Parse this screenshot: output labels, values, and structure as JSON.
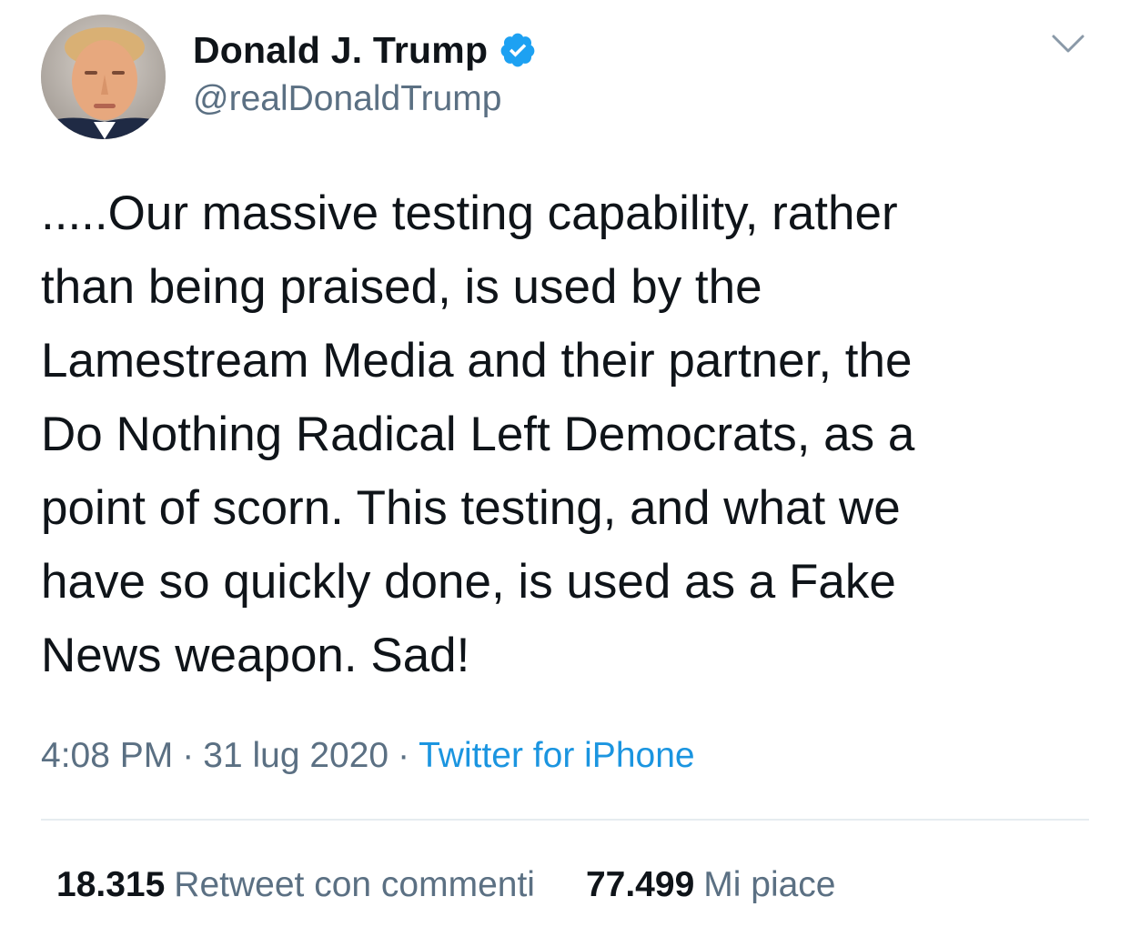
{
  "author": {
    "display_name": "Donald J. Trump",
    "handle": "@realDonaldTrump",
    "verified": true,
    "verified_icon": "verified-badge-icon",
    "avatar_icon": "profile-photo"
  },
  "menu_icon": "chevron-down-icon",
  "tweet": {
    "lines": [
      ".....Our massive testing capability, rather",
      "than being praised, is used by the",
      "Lamestream Media and their partner, the",
      "Do Nothing Radical Left Democrats, as a",
      "point of scorn. This testing, and what we",
      "have so quickly done, is used as a Fake",
      "News weapon. Sad!"
    ]
  },
  "meta": {
    "time": "4:08 PM",
    "separator": "·",
    "date": "31 lug 2020",
    "source": "Twitter for iPhone"
  },
  "stats": {
    "retweets_count": "18.315",
    "retweets_label": "Retweet con commenti",
    "likes_count": "77.499",
    "likes_label": "Mi piace"
  },
  "colors": {
    "text": "#0f1419",
    "secondary": "#5b7083",
    "link": "#1b95e0",
    "verified": "#1da1f2",
    "divider": "#e6ecf0"
  }
}
